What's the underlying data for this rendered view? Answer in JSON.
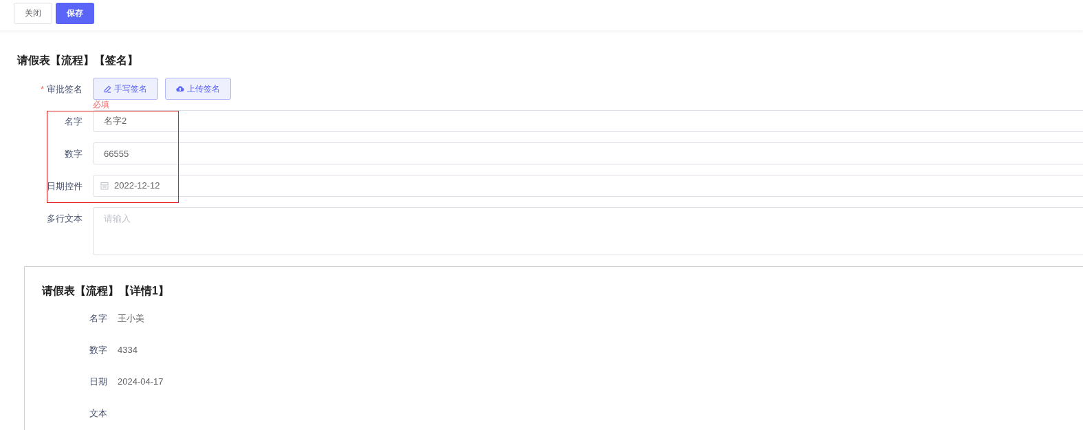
{
  "toolbar": {
    "buttons": [
      {
        "label": "关闭",
        "kind": "default"
      },
      {
        "label": "保存",
        "kind": "primary"
      }
    ]
  },
  "form": {
    "title": "请假表【流程】【签名】",
    "signature": {
      "label": "审批签名",
      "required_mark": "*",
      "buttons": [
        {
          "label": "手写签名",
          "kind": "pen"
        },
        {
          "label": "上传签名",
          "kind": "upload"
        }
      ],
      "error": "必填"
    },
    "fields": [
      {
        "label": "名字",
        "kind": "text",
        "value": "名字2",
        "highlighted": true
      },
      {
        "label": "数字",
        "kind": "text",
        "value": "66555",
        "highlighted": true
      },
      {
        "label": "日期控件",
        "kind": "date",
        "value": "2022-12-12",
        "highlighted": true
      },
      {
        "label": "多行文本",
        "kind": "textarea",
        "placeholder": "请输入",
        "highlighted": false
      }
    ]
  },
  "detail": {
    "title": "请假表【流程】【详情1】",
    "rows": [
      {
        "label": "名字",
        "value": "王小美"
      },
      {
        "label": "数字",
        "value": "4334"
      },
      {
        "label": "日期",
        "value": "2024-04-17"
      },
      {
        "label": "文本"
      }
    ]
  }
}
